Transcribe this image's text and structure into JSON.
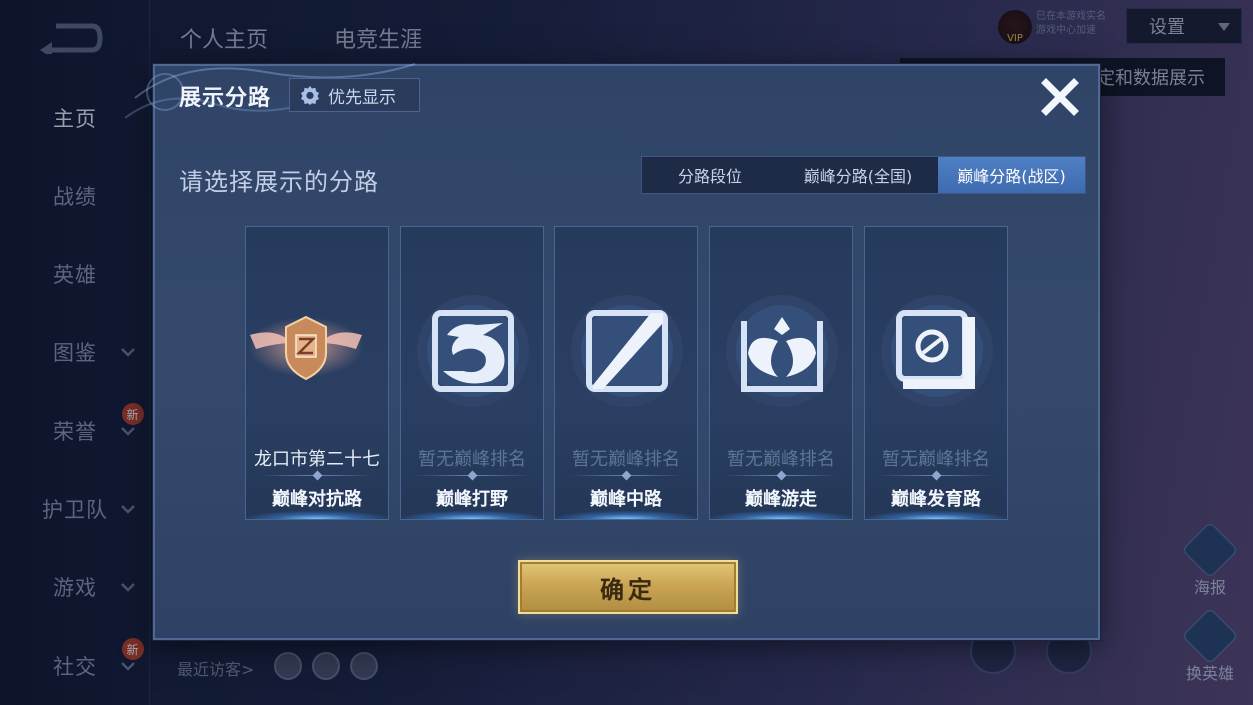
{
  "sidebar": {
    "items": [
      {
        "label": "主页",
        "active": true,
        "chevron": false,
        "badge": ""
      },
      {
        "label": "战绩",
        "active": false,
        "chevron": false,
        "badge": ""
      },
      {
        "label": "英雄",
        "active": false,
        "chevron": false,
        "badge": ""
      },
      {
        "label": "图鉴",
        "active": false,
        "chevron": true,
        "badge": ""
      },
      {
        "label": "荣誉",
        "active": false,
        "chevron": true,
        "badge": "新"
      },
      {
        "label": "护卫队",
        "active": false,
        "chevron": true,
        "badge": ""
      },
      {
        "label": "游戏",
        "active": false,
        "chevron": true,
        "badge": ""
      },
      {
        "label": "社交",
        "active": false,
        "chevron": true,
        "badge": "新"
      }
    ]
  },
  "header": {
    "tabs": [
      "个人主页",
      "电竞生涯"
    ],
    "vip_label": "VIP",
    "qq_note_line1": "已在本游戏实名",
    "qq_note_line2": "游戏中心加速",
    "settings_label": "设置",
    "tooltip_suffix": "定和数据展示"
  },
  "background": {
    "recent_visitors_label": "最近访客>",
    "poster_label": "海报",
    "change_hero_label": "换英雄"
  },
  "dialog": {
    "title": "展示分路",
    "priority_button": "优先显示",
    "subtitle": "请选择展示的分路",
    "segments": [
      {
        "label": "分路段位",
        "active": false
      },
      {
        "label": "巅峰分路(全国)",
        "active": false
      },
      {
        "label": "巅峰分路(战区)",
        "active": true
      }
    ],
    "cards": [
      {
        "rank": "龙口市第二十七",
        "lane": "巅峰对抗路",
        "icon": "bronze-winged-shield-icon",
        "ranked": true
      },
      {
        "rank": "暂无巅峰排名",
        "lane": "巅峰打野",
        "icon": "dragon-icon",
        "ranked": false
      },
      {
        "rank": "暂无巅峰排名",
        "lane": "巅峰中路",
        "icon": "mid-lane-slash-icon",
        "ranked": false
      },
      {
        "rank": "暂无巅峰排名",
        "lane": "巅峰游走",
        "icon": "wings-icon",
        "ranked": false
      },
      {
        "rank": "暂无巅峰排名",
        "lane": "巅峰发育路",
        "icon": "bottom-lane-icon",
        "ranked": false
      }
    ],
    "confirm_label": "确定"
  },
  "colors": {
    "segment_active": "#4677bb",
    "confirm_gold": "#c7a352",
    "dialog_bg": "#34496c"
  }
}
